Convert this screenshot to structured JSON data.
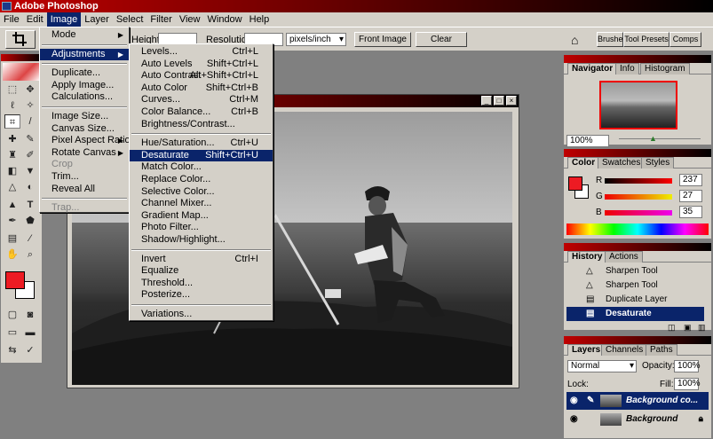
{
  "app": {
    "title": "Adobe Photoshop"
  },
  "menubar": [
    "File",
    "Edit",
    "Image",
    "Layer",
    "Select",
    "Filter",
    "View",
    "Window",
    "Help"
  ],
  "options": {
    "height_label": "Height:",
    "resolution_label": "Resolution:",
    "units": "pixels/inch",
    "front_image": "Front Image",
    "clear": "Clear",
    "well_tabs": [
      "Brushes",
      "Tool Presets",
      "Comps"
    ]
  },
  "image_menu": {
    "items": [
      {
        "label": "Mode",
        "submenu": true
      },
      {
        "label": "Adjustments",
        "submenu": true,
        "selected": true
      },
      {
        "label": "Duplicate..."
      },
      {
        "label": "Apply Image..."
      },
      {
        "label": "Calculations..."
      },
      {
        "label": "Image Size..."
      },
      {
        "label": "Canvas Size..."
      },
      {
        "label": "Pixel Aspect Ratio",
        "submenu": true
      },
      {
        "label": "Rotate Canvas",
        "submenu": true
      },
      {
        "label": "Crop",
        "disabled": true
      },
      {
        "label": "Trim..."
      },
      {
        "label": "Reveal All"
      },
      {
        "label": "Trap...",
        "disabled": true
      }
    ]
  },
  "adjustments_menu": {
    "items": [
      {
        "label": "Levels...",
        "shortcut": "Ctrl+L"
      },
      {
        "label": "Auto Levels",
        "shortcut": "Shift+Ctrl+L"
      },
      {
        "label": "Auto Contrast",
        "shortcut": "Alt+Shift+Ctrl+L"
      },
      {
        "label": "Auto Color",
        "shortcut": "Shift+Ctrl+B"
      },
      {
        "label": "Curves...",
        "shortcut": "Ctrl+M"
      },
      {
        "label": "Color Balance...",
        "shortcut": "Ctrl+B"
      },
      {
        "label": "Brightness/Contrast..."
      },
      {
        "label": "Hue/Saturation...",
        "shortcut": "Ctrl+U"
      },
      {
        "label": "Desaturate",
        "shortcut": "Shift+Ctrl+U",
        "selected": true
      },
      {
        "label": "Match Color..."
      },
      {
        "label": "Replace Color..."
      },
      {
        "label": "Selective Color..."
      },
      {
        "label": "Channel Mixer..."
      },
      {
        "label": "Gradient Map..."
      },
      {
        "label": "Photo Filter..."
      },
      {
        "label": "Shadow/Highlight..."
      },
      {
        "label": "Invert",
        "shortcut": "Ctrl+I"
      },
      {
        "label": "Equalize"
      },
      {
        "label": "Threshold..."
      },
      {
        "label": "Posterize..."
      },
      {
        "label": "Variations..."
      }
    ]
  },
  "navigator": {
    "tabs": [
      "Navigator",
      "Info",
      "Histogram"
    ],
    "zoom": "100%"
  },
  "color": {
    "tabs": [
      "Color",
      "Swatches",
      "Styles"
    ],
    "r": "237",
    "g": "27",
    "b": "35",
    "r_label": "R",
    "g_label": "G",
    "b_label": "B",
    "foreground": "#ed1b23"
  },
  "history": {
    "tabs": [
      "History",
      "Actions"
    ],
    "items": [
      {
        "label": "Sharpen Tool"
      },
      {
        "label": "Sharpen Tool"
      },
      {
        "label": "Duplicate Layer"
      },
      {
        "label": "Desaturate",
        "selected": true
      }
    ]
  },
  "layers": {
    "tabs": [
      "Layers",
      "Channels",
      "Paths"
    ],
    "blend_mode": "Normal",
    "opacity_label": "Opacity:",
    "opacity": "100%",
    "lock_label": "Lock:",
    "fill_label": "Fill:",
    "fill": "100%",
    "items": [
      {
        "name": "Background co...",
        "selected": true
      },
      {
        "name": "Background"
      }
    ]
  }
}
